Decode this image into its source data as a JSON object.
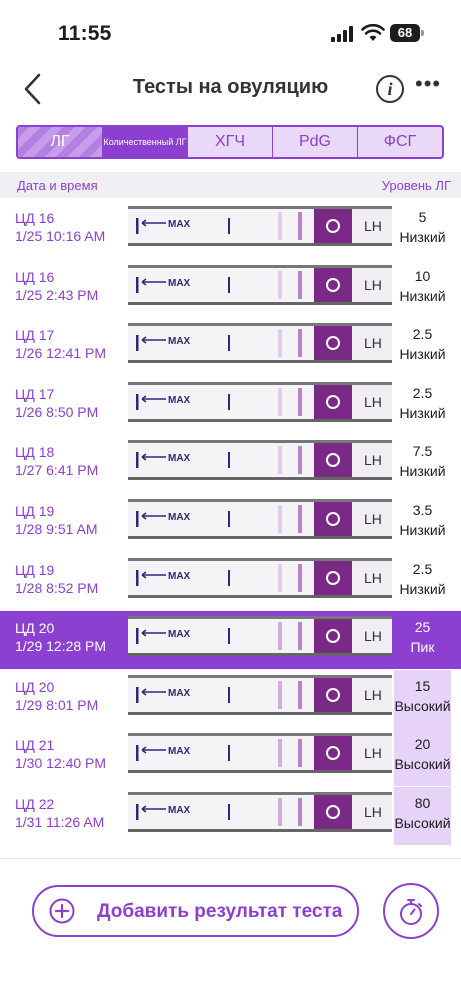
{
  "status_bar": {
    "time": "11:55",
    "battery": "68"
  },
  "nav": {
    "title": "Тесты на овуляцию",
    "info_glyph": "i"
  },
  "tabs": [
    {
      "label": "ЛГ"
    },
    {
      "label": "Количественный ЛГ"
    },
    {
      "label": "ХГЧ"
    },
    {
      "label": "PdG"
    },
    {
      "label": "ФСГ"
    }
  ],
  "list_header": {
    "left": "Дата и время",
    "right": "Уровень ЛГ"
  },
  "rows": [
    {
      "day": "ЦД 16",
      "datetime": "1/25 10:16 AM",
      "value": "5",
      "level": "Низкий"
    },
    {
      "day": "ЦД 16",
      "datetime": "1/25 2:43 PM",
      "value": "10",
      "level": "Низкий"
    },
    {
      "day": "ЦД 17",
      "datetime": "1/26 12:41 PM",
      "value": "2.5",
      "level": "Низкий"
    },
    {
      "day": "ЦД 17",
      "datetime": "1/26 8:50 PM",
      "value": "2.5",
      "level": "Низкий"
    },
    {
      "day": "ЦД 18",
      "datetime": "1/27 6:41 PM",
      "value": "7.5",
      "level": "Низкий"
    },
    {
      "day": "ЦД 19",
      "datetime": "1/28 9:51 AM",
      "value": "3.5",
      "level": "Низкий"
    },
    {
      "day": "ЦД 19",
      "datetime": "1/28 8:52 PM",
      "value": "2.5",
      "level": "Низкий"
    },
    {
      "day": "ЦД 20",
      "datetime": "1/29 12:28 PM",
      "value": "25",
      "level": "Пик"
    },
    {
      "day": "ЦД 20",
      "datetime": "1/29 8:01 PM",
      "value": "15",
      "level": "Высокий"
    },
    {
      "day": "ЦД 21",
      "datetime": "1/30 12:40 PM",
      "value": "20",
      "level": "Высокий"
    },
    {
      "day": "ЦД 22",
      "datetime": "1/31 11:26 AM",
      "value": "80",
      "level": "Высокий"
    }
  ],
  "strip": {
    "max_label": "MAX",
    "lh_label": "LH"
  },
  "bottom": {
    "add_label": "Добавить результат теста"
  },
  "colors": {
    "accent": "#8c3fd0",
    "high_bg": "#e7d3f8",
    "peak": "#8c3fd0"
  },
  "icons": [
    "back-chevron-icon",
    "info-icon",
    "more-icon",
    "plus-circle-icon",
    "timer-icon"
  ]
}
